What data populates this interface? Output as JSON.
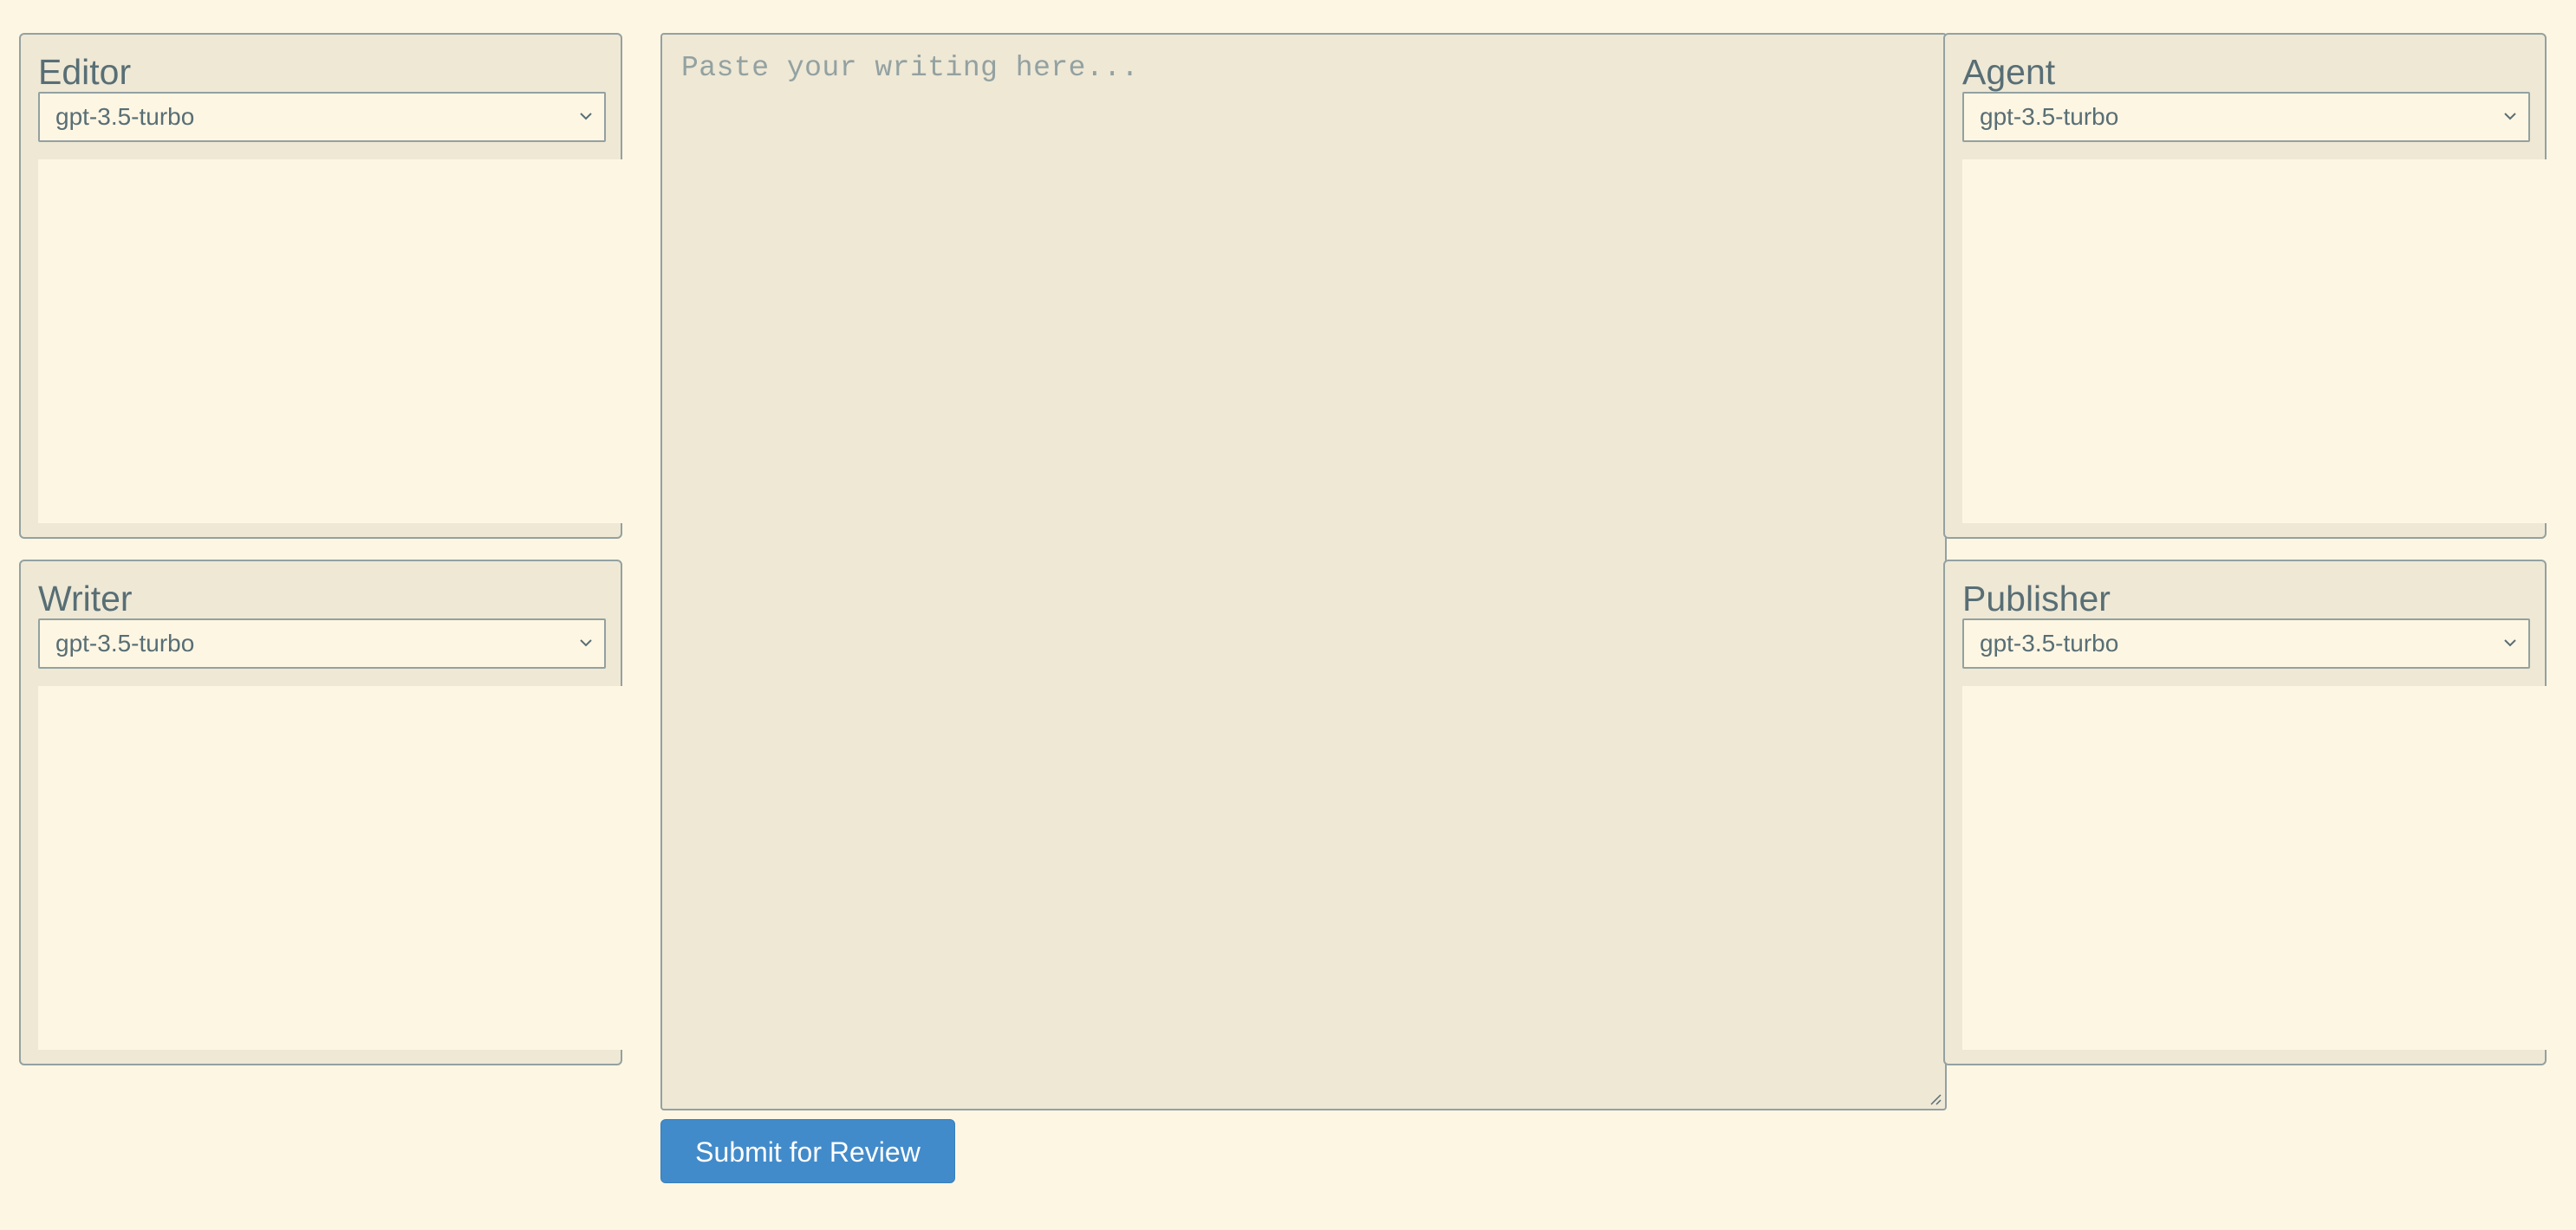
{
  "panels": {
    "editor": {
      "title": "Editor",
      "model": "gpt-3.5-turbo"
    },
    "writer": {
      "title": "Writer",
      "model": "gpt-3.5-turbo"
    },
    "agent": {
      "title": "Agent",
      "model": "gpt-3.5-turbo"
    },
    "publisher": {
      "title": "Publisher",
      "model": "gpt-3.5-turbo"
    }
  },
  "writing": {
    "placeholder": "Paste your writing here...",
    "value": ""
  },
  "submit_label": "Submit for Review",
  "colors": {
    "background": "#fdf6e3",
    "panel": "#eee8d5",
    "border": "#93a1a1",
    "text": "#586e75",
    "accent": "#428bca"
  }
}
